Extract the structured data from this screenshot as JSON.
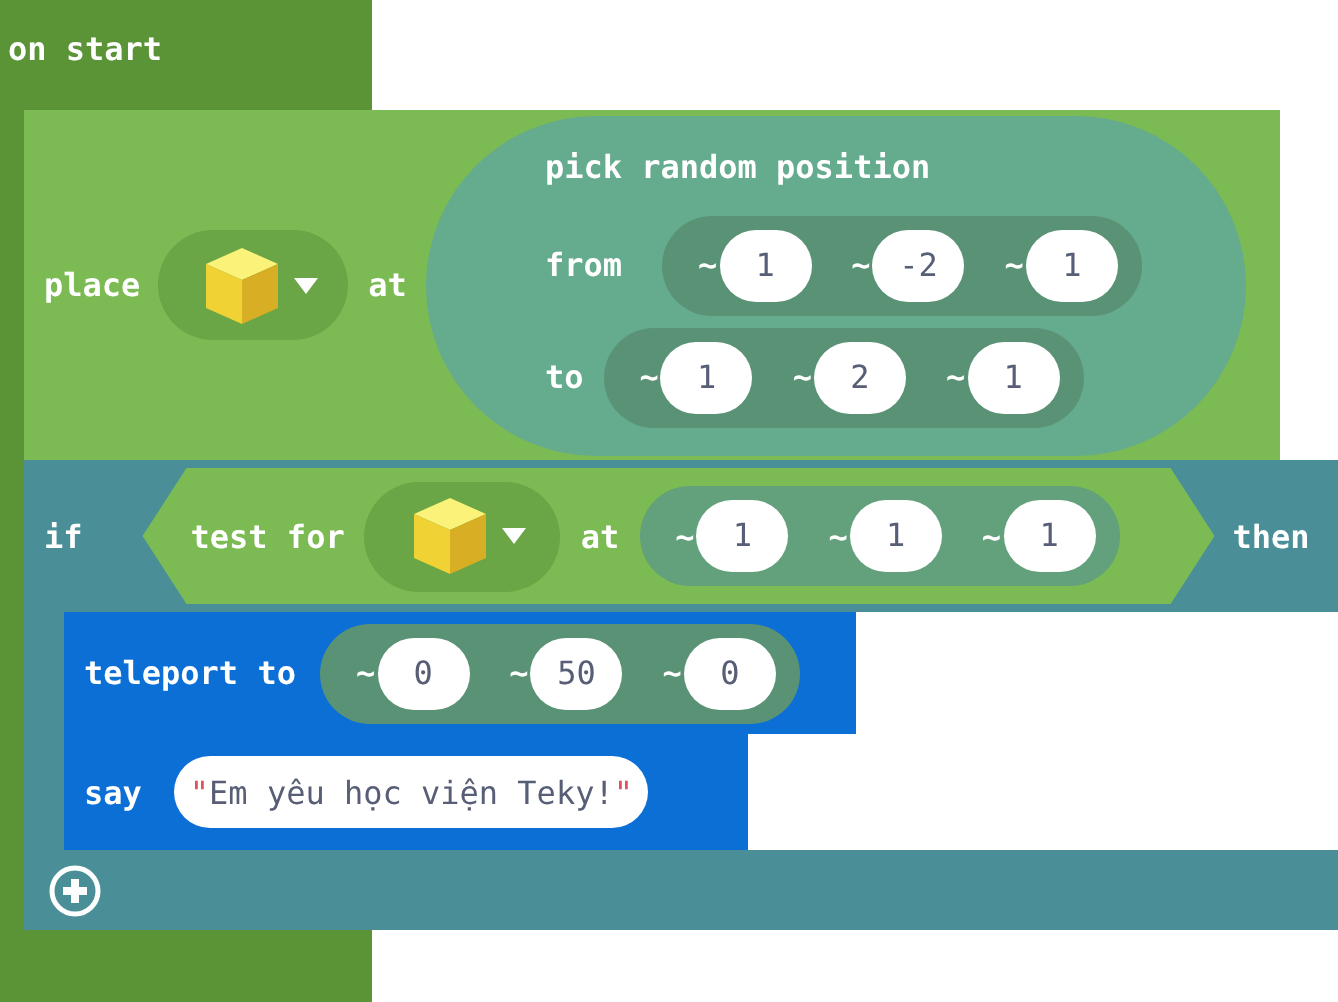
{
  "hat": {
    "label": "on start"
  },
  "place_block": {
    "label": "place",
    "connector": "at",
    "position": {
      "label": "pick random position",
      "rows": [
        {
          "label": "from",
          "coords": [
            {
              "prefix": "~",
              "value": "1"
            },
            {
              "prefix": "~",
              "value": "-2"
            },
            {
              "prefix": "~",
              "value": "1"
            }
          ]
        },
        {
          "label": "to",
          "coords": [
            {
              "prefix": "~",
              "value": "1"
            },
            {
              "prefix": "~",
              "value": "2"
            },
            {
              "prefix": "~",
              "value": "1"
            }
          ]
        }
      ]
    }
  },
  "if_block": {
    "label": "if",
    "condition": {
      "label": "test for",
      "connector": "at",
      "coords": [
        {
          "prefix": "~",
          "value": "1"
        },
        {
          "prefix": "~",
          "value": "1"
        },
        {
          "prefix": "~",
          "value": "1"
        }
      ]
    },
    "then_label": "then",
    "statements": [
      {
        "kind": "teleport",
        "label": "teleport to",
        "coords": [
          {
            "prefix": "~",
            "value": "0"
          },
          {
            "prefix": "~",
            "value": "50"
          },
          {
            "prefix": "~",
            "value": "0"
          }
        ]
      },
      {
        "kind": "say",
        "label": "say",
        "open_quote": "\"",
        "text": "Em yêu học viện Teky!",
        "close_quote": "\""
      }
    ]
  }
}
